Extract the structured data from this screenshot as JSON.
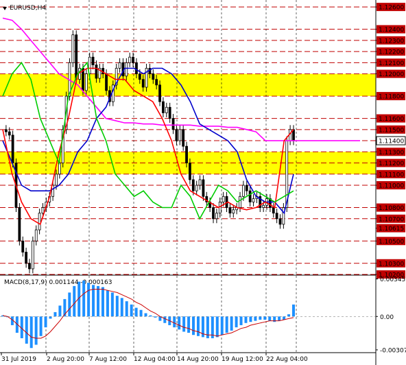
{
  "chart_data": [
    {
      "type": "candlestick",
      "title": "EURUSD,H4",
      "x_labels": [
        "31 Jul 2019",
        "2 Aug 20:00",
        "7 Aug 12:00",
        "12 Aug 04:00",
        "14 Aug 20:00",
        "19 Aug 12:00",
        "22 Aug 04:00"
      ],
      "ylim": [
        1.102,
        1.1265
      ],
      "y_ticks": [
        "1.12600",
        "1.12400",
        "1.12300",
        "1.12200",
        "1.12100",
        "1.12000",
        "1.11800",
        "1.11600",
        "1.11500",
        "1.11400",
        "1.11300",
        "1.11200",
        "1.11100",
        "1.11000",
        "1.10800",
        "1.10700",
        "1.10615",
        "1.10500",
        "1.10300",
        "1.10200"
      ],
      "current_price": "1.11400",
      "level_lines": [
        1.126,
        1.124,
        1.123,
        1.122,
        1.121,
        1.12,
        1.118,
        1.116,
        1.115,
        1.114,
        1.113,
        1.112,
        1.111,
        1.11,
        1.108,
        1.107,
        1.105,
        1.103,
        1.102
      ],
      "highlight_zones": [
        [
          1.118,
          1.12
        ],
        [
          1.111,
          1.113
        ]
      ],
      "highlight_color": "#ffff00",
      "level_color": "#c00000",
      "close_series": [
        1.115,
        1.1148,
        1.1145,
        1.112,
        1.108,
        1.105,
        1.104,
        1.103,
        1.1025,
        1.105,
        1.106,
        1.1075,
        1.108,
        1.1085,
        1.109,
        1.11,
        1.111,
        1.112,
        1.115,
        1.118,
        1.121,
        1.1235,
        1.1195,
        1.1205,
        1.1185,
        1.12,
        1.1215,
        1.1208,
        1.1196,
        1.1205,
        1.12,
        1.1185,
        1.1175,
        1.119,
        1.1205,
        1.121,
        1.1198,
        1.121,
        1.1215,
        1.121,
        1.12,
        1.1195,
        1.1188,
        1.1205,
        1.12,
        1.1195,
        1.119,
        1.1175,
        1.1165,
        1.117,
        1.116,
        1.115,
        1.114,
        1.115,
        1.1135,
        1.112,
        1.1105,
        1.1095,
        1.11,
        1.1105,
        1.109,
        1.1085,
        1.108,
        1.107,
        1.1075,
        1.1085,
        1.109,
        1.108,
        1.1075,
        1.1078,
        1.108,
        1.109,
        1.11,
        1.1095,
        1.1085,
        1.1088,
        1.109,
        1.108,
        1.1082,
        1.1088,
        1.108,
        1.1075,
        1.107,
        1.1065,
        1.108,
        1.114,
        1.115,
        1.114
      ],
      "lines": [
        {
          "color": "#ff00ff",
          "values": [
            1.125,
            1.1248,
            1.124,
            1.123,
            1.122,
            1.121,
            1.12,
            1.1195,
            1.119,
            1.118,
            1.117,
            1.116,
            1.1158,
            1.1156,
            1.1156,
            1.1155,
            1.1155,
            1.1154,
            1.1154,
            1.1154,
            1.1154,
            1.1153,
            1.1153,
            1.1153,
            1.1152,
            1.1152,
            1.115,
            1.1148,
            1.114,
            1.114,
            1.114,
            1.114
          ]
        },
        {
          "color": "#0000cc",
          "values": [
            1.114,
            1.112,
            1.11,
            1.1095,
            1.1095,
            1.1095,
            1.11,
            1.111,
            1.113,
            1.114,
            1.116,
            1.117,
            1.119,
            1.1205,
            1.1205,
            1.12,
            1.1205,
            1.1205,
            1.12,
            1.119,
            1.1175,
            1.1155,
            1.115,
            1.1145,
            1.114,
            1.113,
            1.1105,
            1.109,
            1.1085,
            1.1085,
            1.1075,
            1.111
          ]
        },
        {
          "color": "#ff0000",
          "values": [
            1.115,
            1.111,
            1.1085,
            1.107,
            1.1065,
            1.109,
            1.113,
            1.116,
            1.12,
            1.1205,
            1.1205,
            1.12,
            1.1195,
            1.1195,
            1.1185,
            1.118,
            1.1175,
            1.116,
            1.114,
            1.111,
            1.1095,
            1.109,
            1.1085,
            1.108,
            1.1085,
            1.108,
            1.1078,
            1.108,
            1.1085,
            1.108,
            1.114,
            1.115
          ]
        },
        {
          "color": "#00cc00",
          "values": [
            1.118,
            1.12,
            1.121,
            1.1195,
            1.116,
            1.114,
            1.112,
            1.118,
            1.12,
            1.121,
            1.116,
            1.114,
            1.111,
            1.11,
            1.109,
            1.1095,
            1.1085,
            1.108,
            1.108,
            1.11,
            1.109,
            1.107,
            1.1085,
            1.11,
            1.1095,
            1.1085,
            1.109,
            1.1095,
            1.109,
            1.1085,
            1.109,
            1.1095
          ]
        }
      ]
    },
    {
      "type": "bar",
      "title": "MACD(8,17,9) 0.001144 -0.000163",
      "ylim": [
        -0.0032,
        0.00355
      ],
      "y_ticks": [
        "0.00345",
        "0.00",
        "-0.00307"
      ],
      "series": [
        {
          "color": "#1e90ff",
          "values": [
            0.0001,
            0.0,
            -0.0008,
            -0.0015,
            -0.002,
            -0.0025,
            -0.0029,
            -0.0026,
            -0.0018,
            -0.001,
            -0.0002,
            0.0004,
            0.001,
            0.0016,
            0.0022,
            0.0028,
            0.0032,
            0.0033,
            0.0031,
            0.0029,
            0.0028,
            0.0027,
            0.0024,
            0.0022,
            0.0019,
            0.0017,
            0.0014,
            0.0011,
            0.0008,
            0.0006,
            0.0003,
            0.0001,
            -0.0001,
            -0.0004,
            -0.0006,
            -0.0008,
            -0.001,
            -0.0012,
            -0.0014,
            -0.0015,
            -0.0017,
            -0.0018,
            -0.0019,
            -0.002,
            -0.002,
            -0.0019,
            -0.0017,
            -0.0015,
            -0.0013,
            -0.001,
            -0.0008,
            -0.0006,
            -0.0005,
            -0.0004,
            -0.0003,
            -0.0003,
            -0.0004,
            -0.0005,
            -0.0004,
            -0.0003,
            0.0002,
            0.0011
          ]
        },
        {
          "color": "#cc0000",
          "values": [
            0.0001,
            0.0,
            -0.0003,
            -0.0007,
            -0.0011,
            -0.0015,
            -0.0019,
            -0.002,
            -0.002,
            -0.0018,
            -0.0014,
            -0.0009,
            -0.0004,
            0.0002,
            0.0007,
            0.0012,
            0.0017,
            0.0021,
            0.0024,
            0.0025,
            0.0025,
            0.0025,
            0.0024,
            0.0023,
            0.0022,
            0.002,
            0.0018,
            0.0016,
            0.0013,
            0.0011,
            0.0008,
            0.0005,
            0.0003,
            0.0,
            -0.0002,
            -0.0004,
            -0.0006,
            -0.0008,
            -0.001,
            -0.0011,
            -0.0013,
            -0.0014,
            -0.0016,
            -0.0017,
            -0.0017,
            -0.0018,
            -0.0017,
            -0.0016,
            -0.0015,
            -0.0013,
            -0.0011,
            -0.001,
            -0.0008,
            -0.0007,
            -0.0006,
            -0.0005,
            -0.0004,
            -0.0004,
            -0.0004,
            -0.0003,
            -0.0002,
            -0.0001
          ]
        }
      ]
    }
  ]
}
